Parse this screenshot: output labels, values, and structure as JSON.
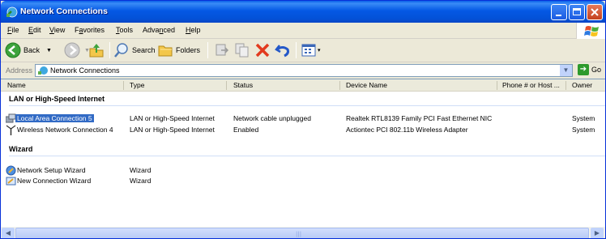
{
  "window": {
    "title": "Network Connections"
  },
  "menu": [
    {
      "label": "File",
      "key": "F",
      "rest": "ile"
    },
    {
      "label": "Edit",
      "key": "E",
      "rest": "dit"
    },
    {
      "label": "View",
      "key": "V",
      "rest": "iew"
    },
    {
      "label": "Favorites",
      "key": "a",
      "pre": "F",
      "rest": "vorites"
    },
    {
      "label": "Tools",
      "key": "T",
      "rest": "ools"
    },
    {
      "label": "Advanced",
      "key": "n",
      "pre": "Adva",
      "rest": "ced"
    },
    {
      "label": "Help",
      "key": "H",
      "rest": "elp"
    }
  ],
  "toolbar": {
    "back_label": "Back",
    "search_label": "Search",
    "folders_label": "Folders"
  },
  "address": {
    "label": "Address",
    "value": "Network Connections",
    "go_label": "Go"
  },
  "columns": [
    "Name",
    "Type",
    "Status",
    "Device Name",
    "Phone # or Host ...",
    "Owner"
  ],
  "groups": [
    {
      "title": "LAN or High-Speed Internet",
      "items": [
        {
          "name": "Local Area Connection 5",
          "type": "LAN or High-Speed Internet",
          "status": "Network cable unplugged",
          "device": "Realtek RTL8139 Family PCI Fast Ethernet NIC",
          "phone": "",
          "owner": "System",
          "selected": true,
          "icon": "lan-connection-icon"
        },
        {
          "name": "Wireless Network Connection 4",
          "type": "LAN or High-Speed Internet",
          "status": "Enabled",
          "device": "Actiontec PCI 802.11b Wireless Adapter",
          "phone": "",
          "owner": "System",
          "selected": false,
          "icon": "wireless-connection-icon"
        }
      ]
    },
    {
      "title": "Wizard",
      "items": [
        {
          "name": "Network Setup Wizard",
          "type": "Wizard",
          "status": "",
          "device": "",
          "phone": "",
          "owner": "",
          "selected": false,
          "icon": "network-setup-wizard-icon"
        },
        {
          "name": "New Connection Wizard",
          "type": "Wizard",
          "status": "",
          "device": "",
          "phone": "",
          "owner": "",
          "selected": false,
          "icon": "new-connection-wizard-icon"
        }
      ]
    }
  ]
}
